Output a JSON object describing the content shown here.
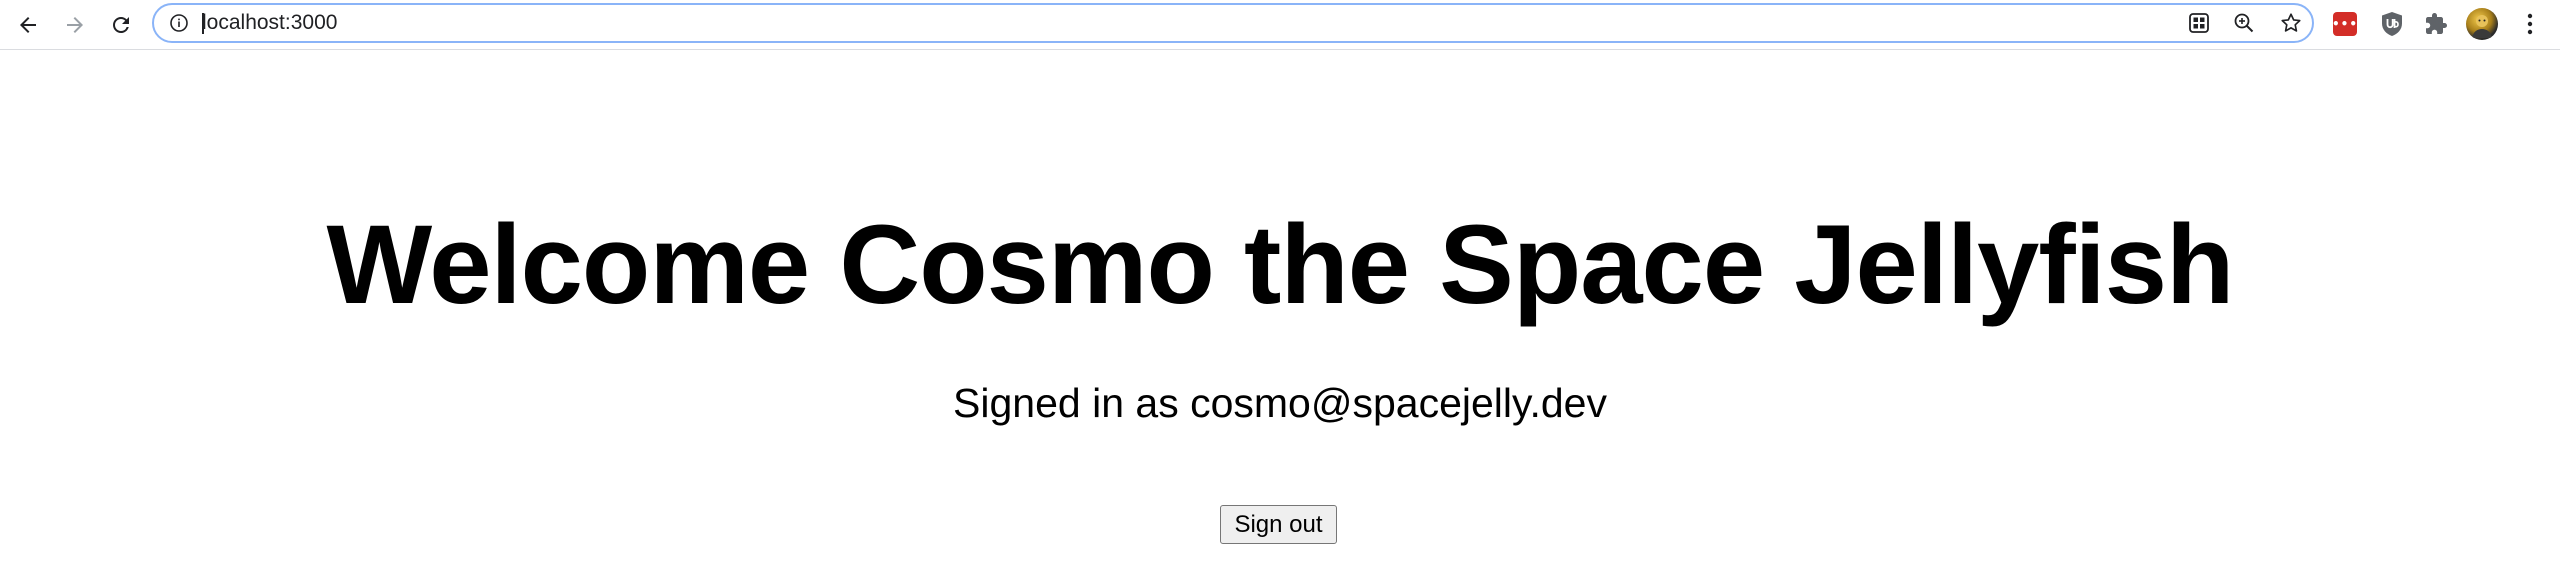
{
  "browser": {
    "url": "localhost:3000",
    "extensions": [
      "lastpass",
      "ublock-origin",
      "extensions-puzzle",
      "profile-avatar"
    ],
    "lastpass_badge": "•••"
  },
  "page": {
    "heading": "Welcome Cosmo the Space Jellyfish",
    "signed_in_text": "Signed in as cosmo@spacejelly.dev",
    "sign_out_label": "Sign out"
  }
}
